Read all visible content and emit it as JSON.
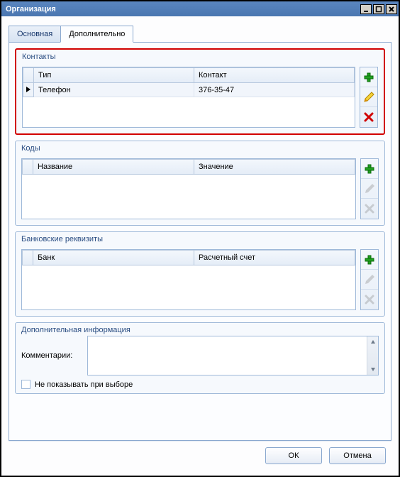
{
  "window": {
    "title": "Организация"
  },
  "tabs": {
    "main": "Основная",
    "additional": "Дополнительно"
  },
  "groups": {
    "contacts": {
      "title": "Контакты",
      "cols": {
        "type": "Тип",
        "contact": "Контакт"
      },
      "rows": [
        {
          "type": "Телефон",
          "contact": "376-35-47"
        }
      ]
    },
    "codes": {
      "title": "Коды",
      "cols": {
        "name": "Название",
        "value": "Значение"
      },
      "rows": []
    },
    "bank": {
      "title": "Банковские реквизиты",
      "cols": {
        "bank": "Банк",
        "account": "Расчетный счет"
      },
      "rows": []
    },
    "extra": {
      "title": "Дополнительная информация",
      "comment_label": "Комментарии:",
      "comment_value": "",
      "hide_label": "Не показывать при выборе",
      "hide_checked": false
    }
  },
  "footer": {
    "ok": "ОК",
    "cancel": "Отмена"
  }
}
